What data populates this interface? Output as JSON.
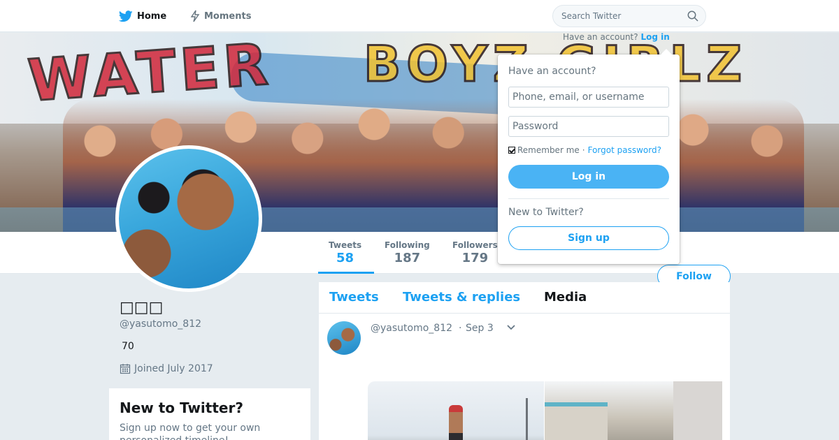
{
  "nav": {
    "home_label": "Home",
    "moments_label": "Moments",
    "search_placeholder": "Search Twitter",
    "have_account_text": "Have an account?",
    "login_link": "Log in"
  },
  "profile": {
    "name": "□□□",
    "handle": "@yasutomo_812",
    "bio": "70",
    "joined": "Joined July 2017",
    "follow_label": "Follow",
    "stats": {
      "tweets_label": "Tweets",
      "tweets_value": "58",
      "following_label": "Following",
      "following_value": "187",
      "followers_label": "Followers",
      "followers_value": "179"
    }
  },
  "signup_card": {
    "title": "New to Twitter?",
    "text": "Sign up now to get your own personalized timeline!"
  },
  "timeline": {
    "tabs": [
      "Tweets",
      "Tweets & replies",
      "Media"
    ],
    "active_tab": "Media",
    "tweet": {
      "handle": "@yasutomo_812",
      "separator": "·",
      "date": "Sep 3"
    }
  },
  "login_popup": {
    "title": "Have an account?",
    "username_placeholder": "Phone, email, or username",
    "password_placeholder": "Password",
    "remember_label": "Remember me",
    "separator": "·",
    "forgot_label": "Forgot password?",
    "login_button": "Log in",
    "new_text": "New to Twitter?",
    "signup_button": "Sign up"
  },
  "colors": {
    "accent": "#1da1f2",
    "background": "#e6ecf0"
  },
  "icons": [
    "twitter-bird-icon",
    "moments-bolt-icon",
    "search-icon",
    "calendar-icon",
    "chevron-down-icon"
  ]
}
